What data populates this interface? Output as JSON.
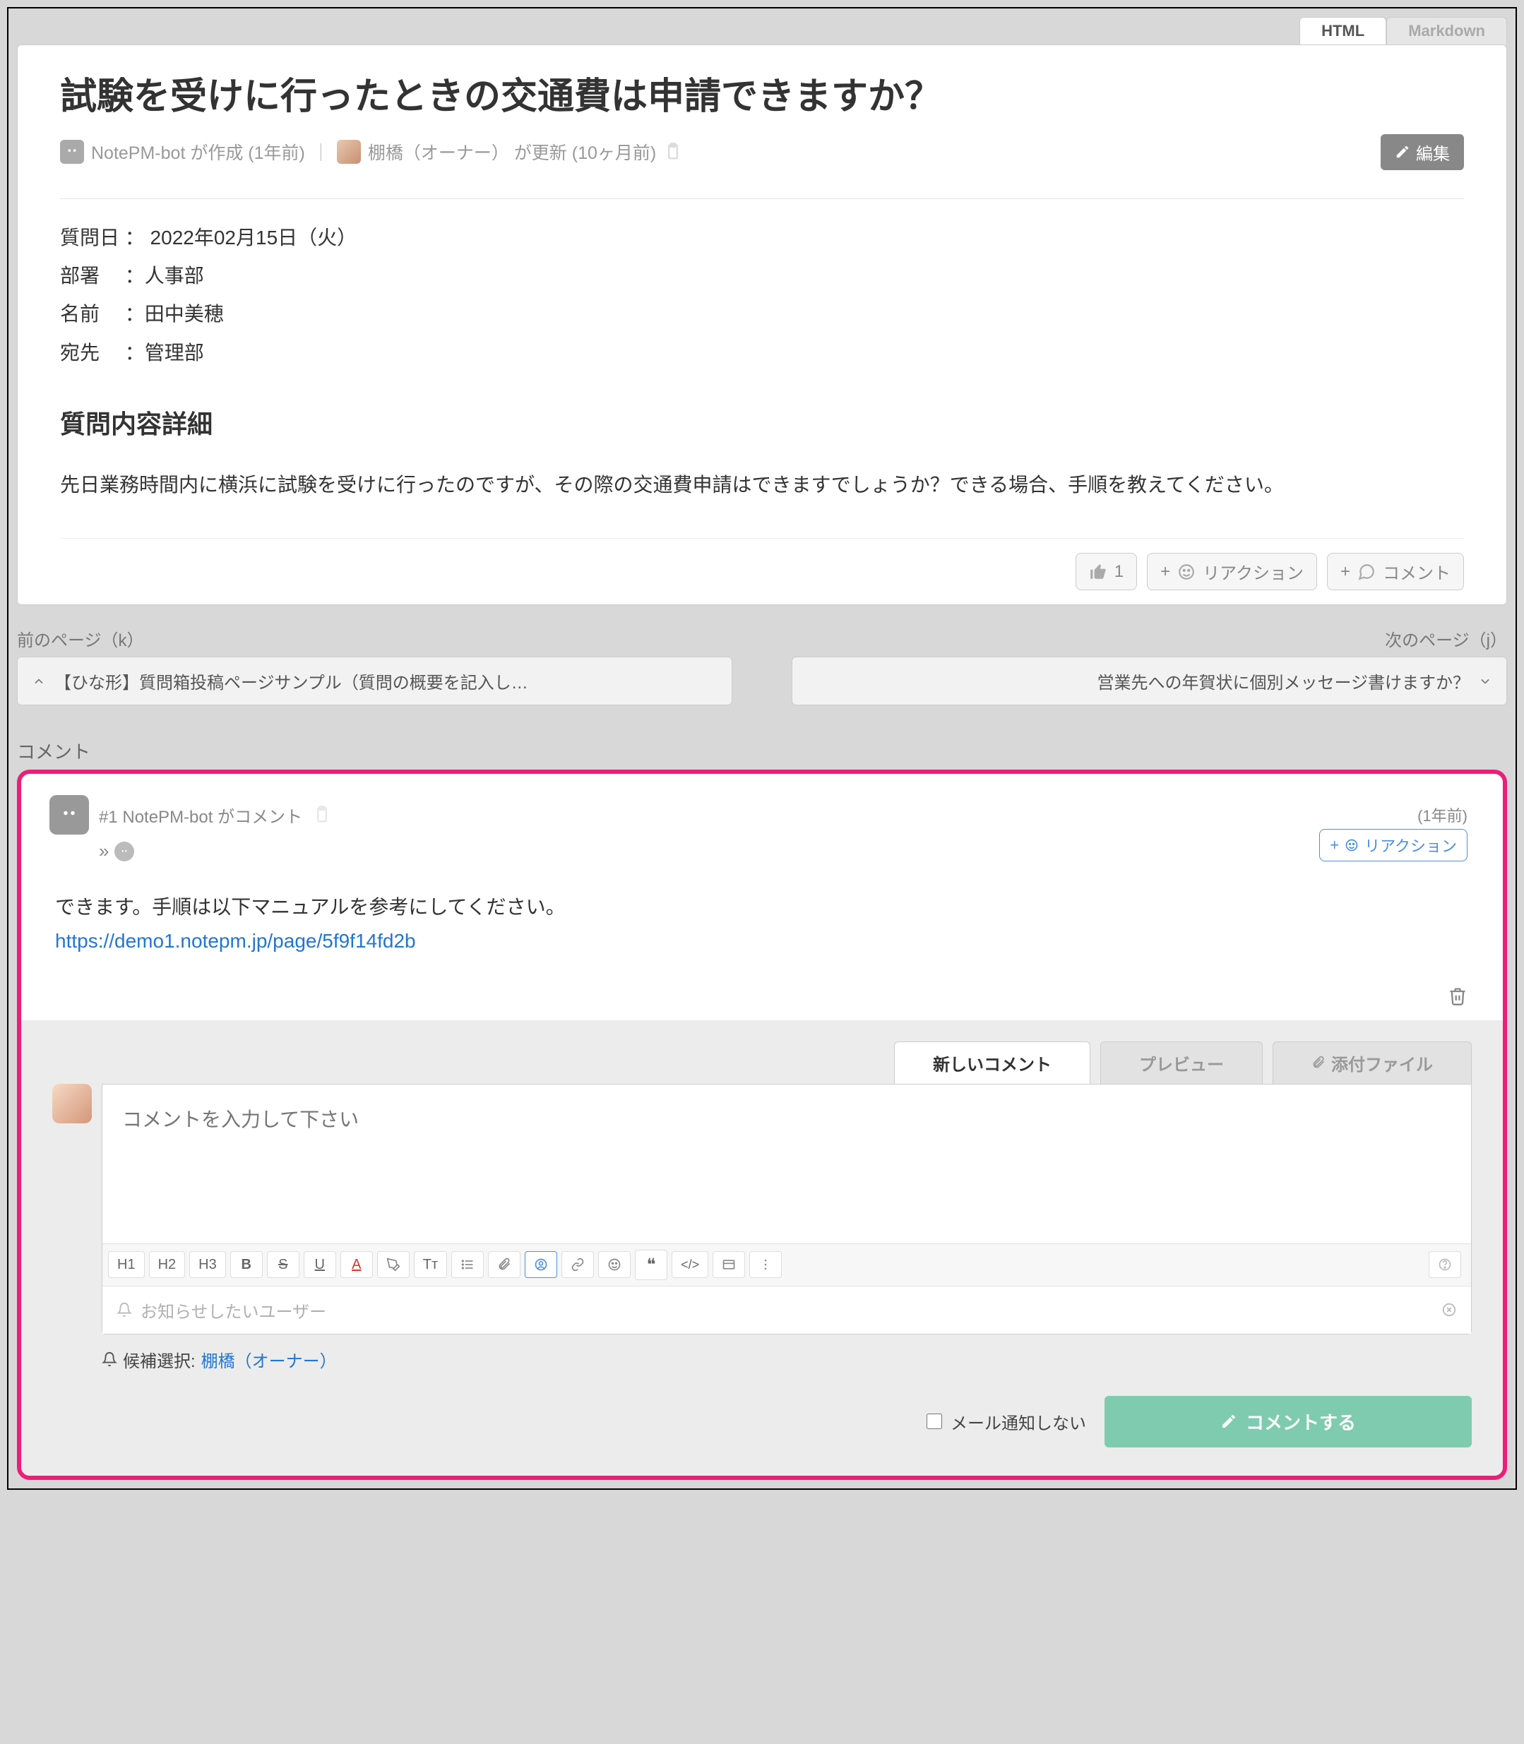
{
  "top_tabs": {
    "html": "HTML",
    "markdown": "Markdown"
  },
  "article": {
    "title": "試験を受けに行ったときの交通費は申請できますか？",
    "created_by": "NotePM-bot が作成 (1年前)",
    "updated_by": "棚橋（オーナー） が更新 (10ヶ月前)",
    "edit_label": "編集",
    "fields": {
      "date": "質問日 ： 2022年02月15日（火）",
      "dept": "部署　 ：人事部",
      "name": "名前　 ：田中美穂",
      "to": "宛先　 ：管理部"
    },
    "section_heading": "質問内容詳細",
    "body": "先日業務時間内に横浜に試験を受けに行ったのですが、その際の交通費申請はできますでしょうか？できる場合、手順を教えてください。",
    "actions": {
      "like_count": "1",
      "reaction": "リアクション",
      "comment": "コメント"
    }
  },
  "pager": {
    "prev_label": "前のページ（k）",
    "next_label": "次のページ（j）",
    "prev": "【ひな形】質問箱投稿ページサンプル（質問の概要を記入し…",
    "next": "営業先への年賀状に個別メッセージ書けますか？"
  },
  "comments": {
    "label": "コメント",
    "items": [
      {
        "head": "#1 NotePM-bot がコメント",
        "ts": "(1年前)",
        "reaction_btn": "リアクション",
        "body_text": "できます。手順は以下マニュアルを参考にしてください。",
        "link": "https://demo1.notepm.jp/page/5f9f14fd2b"
      }
    ]
  },
  "editor": {
    "tabs": {
      "new": "新しいコメント",
      "preview": "プレビュー",
      "attach": "添付ファイル"
    },
    "placeholder": "コメントを入力して下さい",
    "toolbar": [
      "H1",
      "H2",
      "H3",
      "B",
      "S",
      "U",
      "A",
      "✎",
      "Tᴛ",
      "≣",
      "📎",
      "☺",
      "🔗",
      "☺",
      "❝",
      "</>",
      "▭",
      "⋮"
    ],
    "notify_placeholder": "お知らせしたいユーザー",
    "suggest_label": "候補選択:",
    "suggest_user": "棚橋（オーナー）",
    "no_mail": "メール通知しない",
    "submit": "コメントする"
  }
}
